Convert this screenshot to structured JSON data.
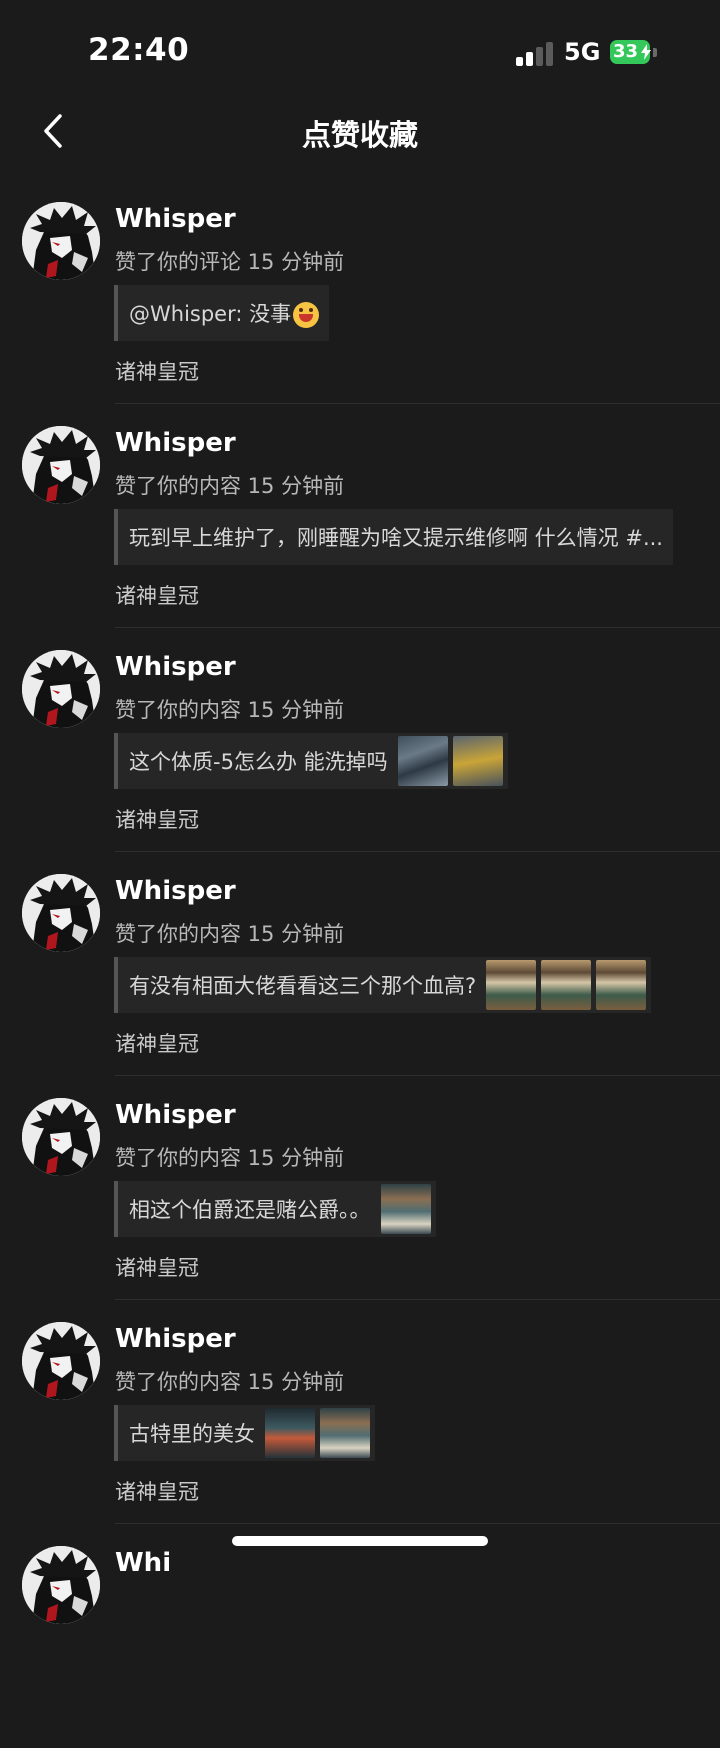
{
  "status_bar": {
    "time": "22:40",
    "network": "5G",
    "battery": "33"
  },
  "header": {
    "title": "点赞收藏"
  },
  "items": [
    {
      "user": "Whisper",
      "action": "赞了你的评论 15 分钟前",
      "content": "@Whisper: 没事",
      "emoji": "grinning-emoji",
      "thumbs": [],
      "game": "诸神皇冠"
    },
    {
      "user": "Whisper",
      "action": "赞了你的内容 15 分钟前",
      "content": "玩到早上维护了，刚睡醒为啥又提示维修啊 什么情况 #...",
      "thumbs": [],
      "game": "诸神皇冠"
    },
    {
      "user": "Whisper",
      "action": "赞了你的内容 15 分钟前",
      "content": "这个体质-5怎么办 能洗掉吗",
      "thumbs": [
        "t1",
        "t2"
      ],
      "game": "诸神皇冠"
    },
    {
      "user": "Whisper",
      "action": "赞了你的内容 15 分钟前",
      "content": "有没有相面大佬看看这三个那个血高?",
      "thumbs": [
        "t3",
        "t3",
        "t3"
      ],
      "game": "诸神皇冠"
    },
    {
      "user": "Whisper",
      "action": "赞了你的内容 15 分钟前",
      "content": "相这个伯爵还是赌公爵。。",
      "thumbs": [
        "t4"
      ],
      "game": "诸神皇冠"
    },
    {
      "user": "Whisper",
      "action": "赞了你的内容 15 分钟前",
      "content": "古特里的美女",
      "thumbs": [
        "t5",
        "t4"
      ],
      "game": "诸神皇冠"
    },
    {
      "user": "Whi",
      "action": "",
      "content": "",
      "thumbs": [],
      "game": ""
    }
  ]
}
